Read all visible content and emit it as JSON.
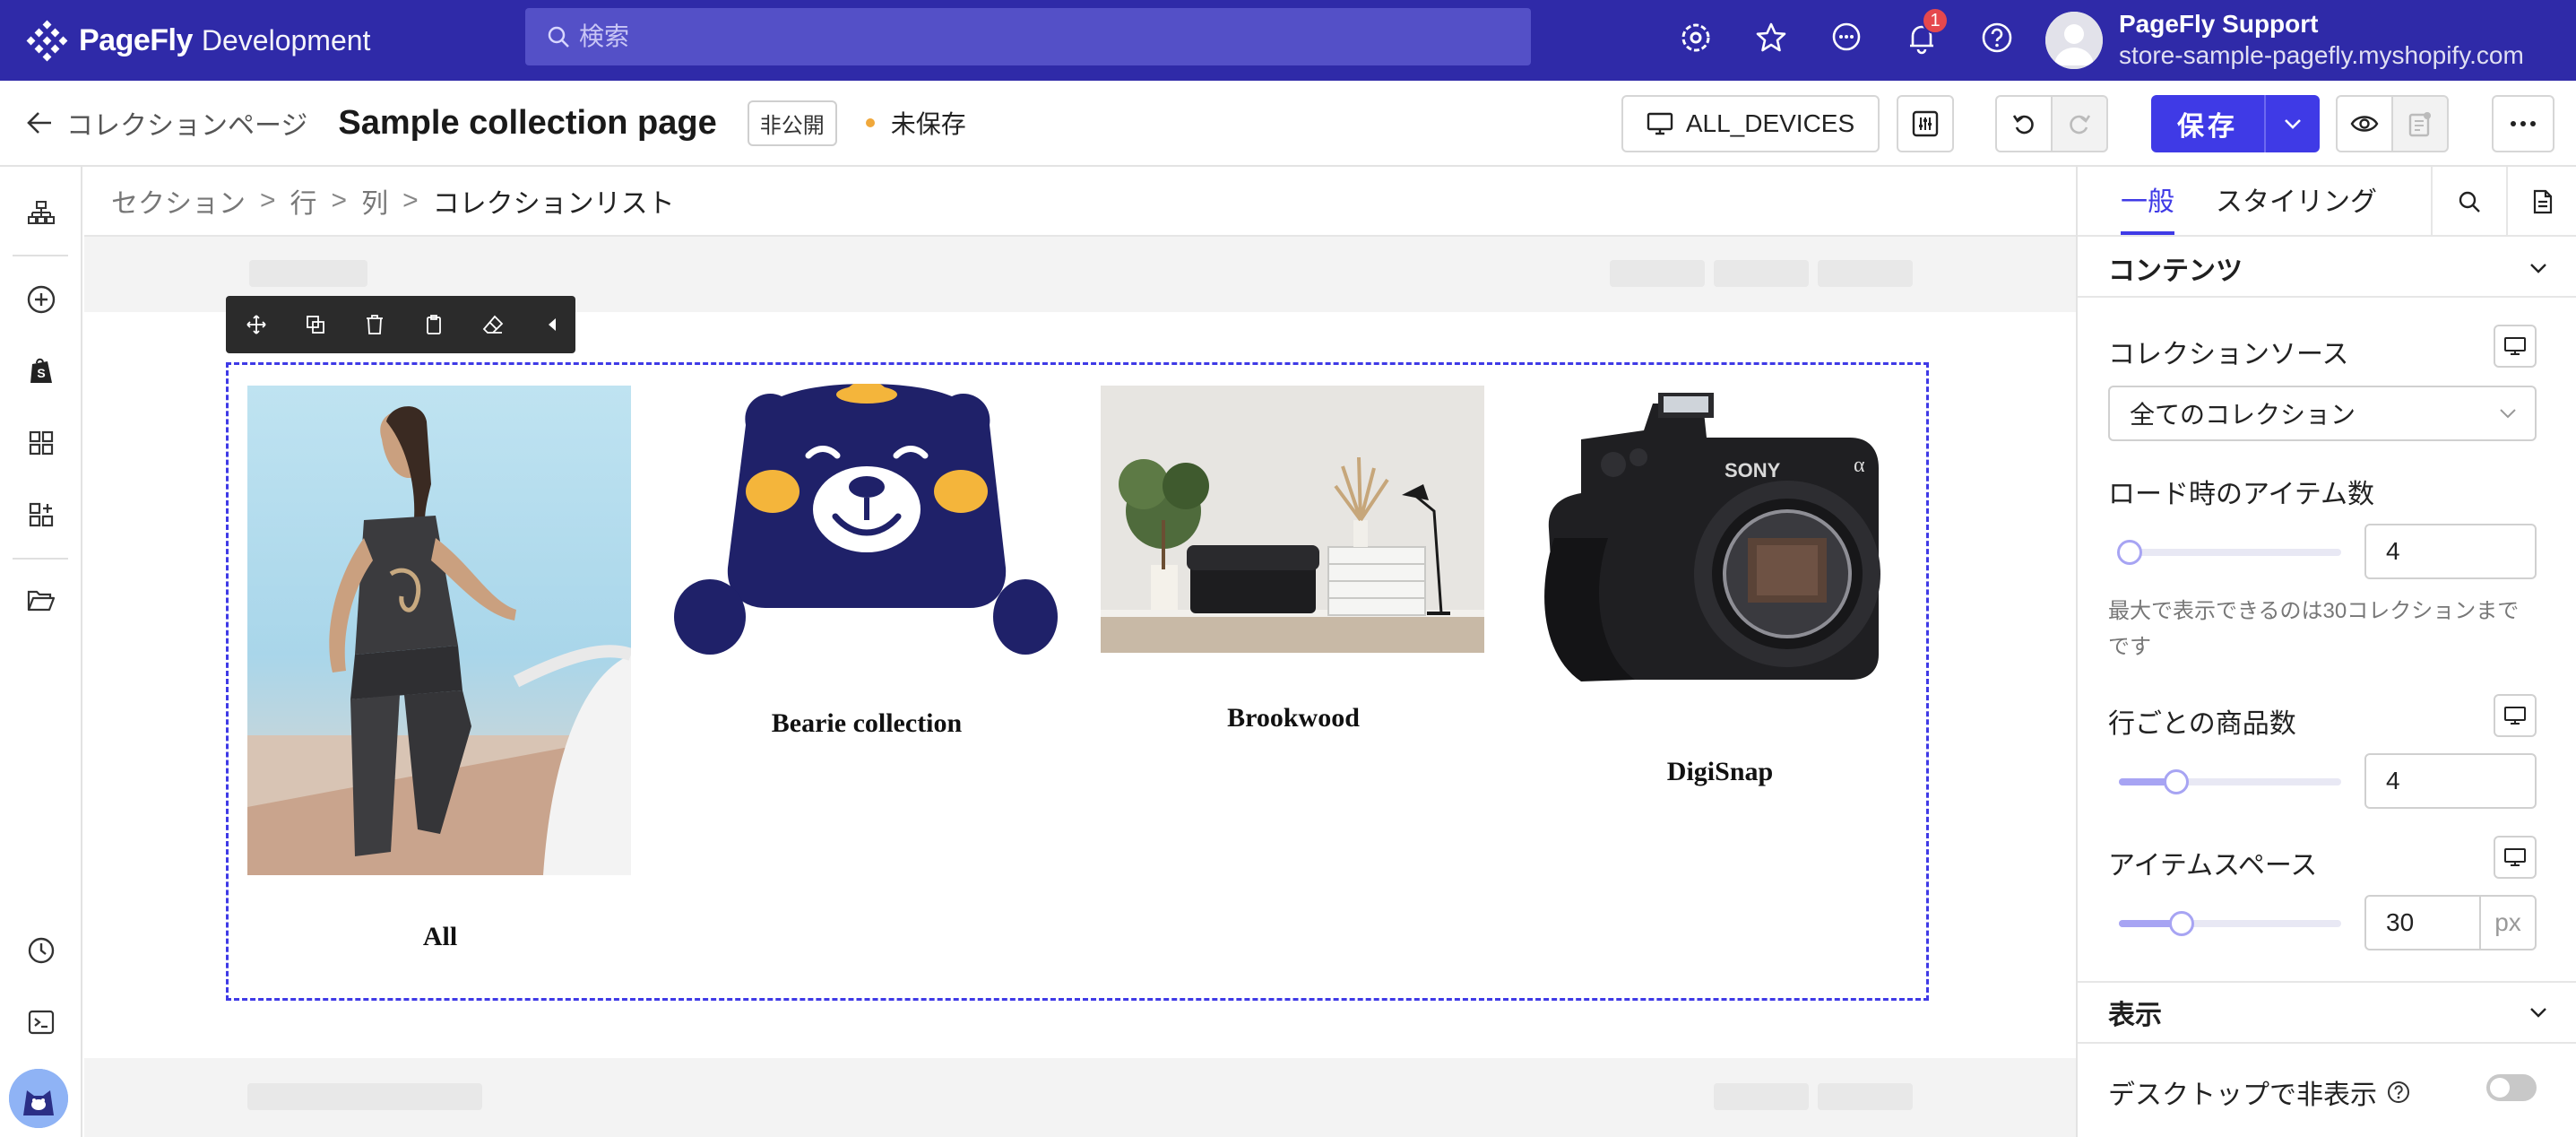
{
  "topbar": {
    "brand_name": "PageFly",
    "brand_env": "Development",
    "search_placeholder": "検索",
    "notification_count": "1",
    "user_name": "PageFly Support",
    "user_store": "store-sample-pagefly.myshopify.com"
  },
  "pagebar": {
    "back_label": "コレクションページ",
    "title": "Sample collection page",
    "visibility_badge": "非公開",
    "unsaved_label": "未保存",
    "devices_label": "ALL_DEVICES",
    "save_label": "保存"
  },
  "breadcrumb": {
    "items": [
      "セクション",
      "行",
      "列"
    ],
    "separator": ">",
    "current": "コレクションリスト"
  },
  "collections": [
    {
      "title": "All",
      "image": "woman-athlete-photo"
    },
    {
      "title": "Bearie collection",
      "image": "bear-mascot-illustration"
    },
    {
      "title": "Brookwood",
      "image": "living-room-sofa-photo"
    },
    {
      "title": "DigiSnap",
      "image": "sony-camera-photo"
    }
  ],
  "panel": {
    "tab_general": "一般",
    "tab_styling": "スタイリング",
    "content_section": "コンテンツ",
    "collection_source_label": "コレクションソース",
    "collection_source_value": "全てのコレクション",
    "items_on_load_label": "ロード時のアイテム数",
    "items_on_load_value": "4",
    "items_on_load_help": "最大で表示できるのは30コレクションまでです",
    "per_row_label": "行ごとの商品数",
    "per_row_value": "4",
    "item_space_label": "アイテムスペース",
    "item_space_value": "30",
    "item_space_unit": "px",
    "display_section": "表示",
    "hide_desktop_label": "デスクトップで非表示",
    "hide_desktop_enabled": false
  },
  "colors": {
    "topbar": "#2f2aa8",
    "accent": "#3f3ae6",
    "unsaved_dot": "#f0a83b"
  }
}
